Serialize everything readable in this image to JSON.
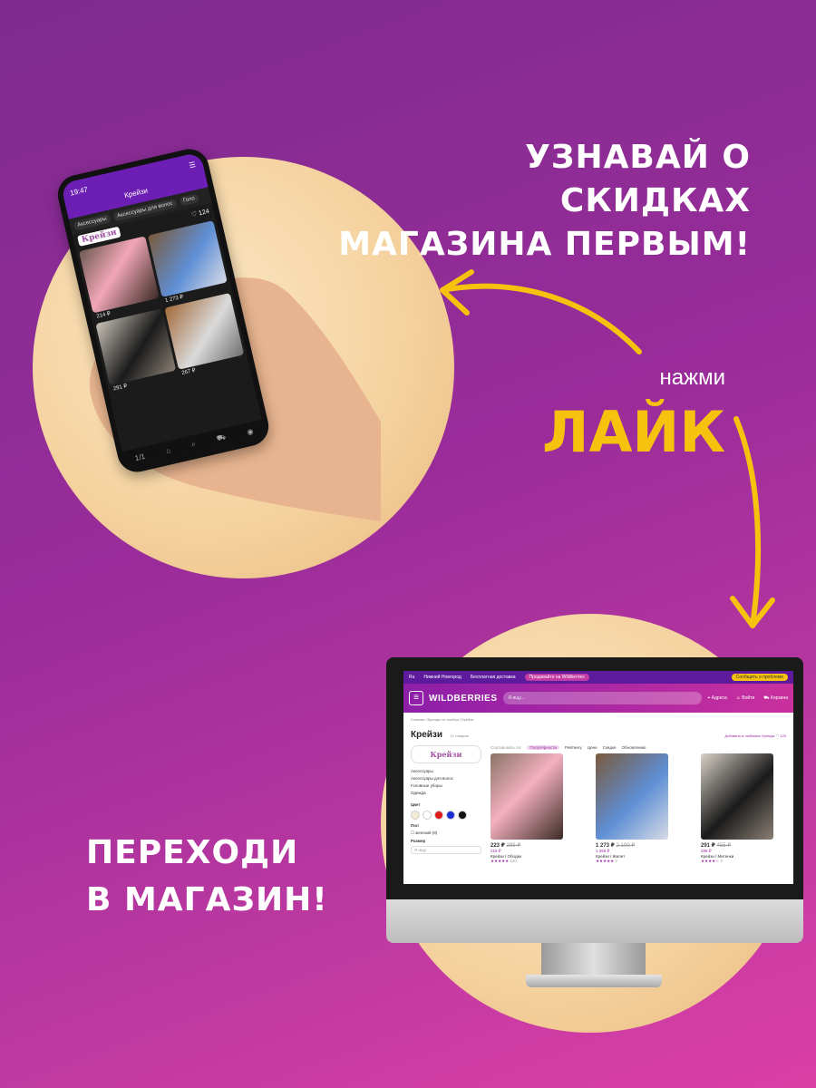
{
  "headline_top": [
    "УЗНАВАЙ О СКИДКАХ",
    "МАГАЗИНА ПЕРВЫМ!"
  ],
  "cta_press": "нажми",
  "cta_like": "ЛАЙК",
  "headline_bottom": [
    "ПЕРЕХОДИ",
    "В МАГАЗИН!"
  ],
  "colors": {
    "accent_yellow": "#f6c20e",
    "brand_purple": "#7d2b8f",
    "brand_pink": "#db3fa6"
  },
  "phone": {
    "time": "19:47",
    "store_title": "Крейзи",
    "chips": [
      "Аксессуары",
      "Аксессуары для волос",
      "Голо"
    ],
    "like_count": "124",
    "brand_logo": "Крейзи",
    "prices": [
      "214 ₽",
      "1 273 ₽",
      "291 ₽",
      "267 ₽"
    ],
    "product_brand": "Крейзи",
    "page_indicator": "1/1"
  },
  "site": {
    "top_links": [
      "Ru",
      "Нижний Новгород",
      "Бесплатная доставка",
      "Продавайте на Wildberries",
      "Сообщить о проблеме"
    ],
    "logo": "WILDBERRIES",
    "search_placeholder": "Я ищу...",
    "header_icons": [
      "Адреса",
      "Войти",
      "Корзина"
    ],
    "breadcrumbs": "Главная / Бренды на ноябрь / Крейзи",
    "store_title": "Крейзи",
    "item_count": "11 товаров",
    "fav_text": "Добавить в любимые бренды",
    "fav_count": "125",
    "brand_logo": "Крейзи",
    "categories": [
      "Аксессуары",
      "Аксессуары для волос",
      "Головные уборы",
      "Одежда"
    ],
    "filter_color": "Цвет",
    "filter_gender": "Пол",
    "gender_option": "женский (8)",
    "filter_size": "Размер",
    "size_placeholder": "Я ищу",
    "sort_label": "Сортировать по:",
    "sort_options": [
      "Популярности",
      "Рейтингу",
      "Цене",
      "Скидке",
      "Обновлению"
    ],
    "products": [
      {
        "price": "223 ₽",
        "old": "299 ₽",
        "promo": "219 ₽",
        "brand": "Крейзи / Ободки",
        "reviews": "120"
      },
      {
        "price": "1 273 ₽",
        "old": "2 100 ₽",
        "promo": "1 259 ₽",
        "brand": "Крейзи / Жилет",
        "reviews": "2"
      },
      {
        "price": "291 ₽",
        "old": "455 ₽",
        "promo": "288 ₽",
        "brand": "Крейзи / Митенки",
        "reviews": "3"
      }
    ],
    "swatch_colors": [
      "#f3ecd4",
      "#ffffff",
      "#e01b1b",
      "#1a2fd4",
      "#111111"
    ]
  }
}
